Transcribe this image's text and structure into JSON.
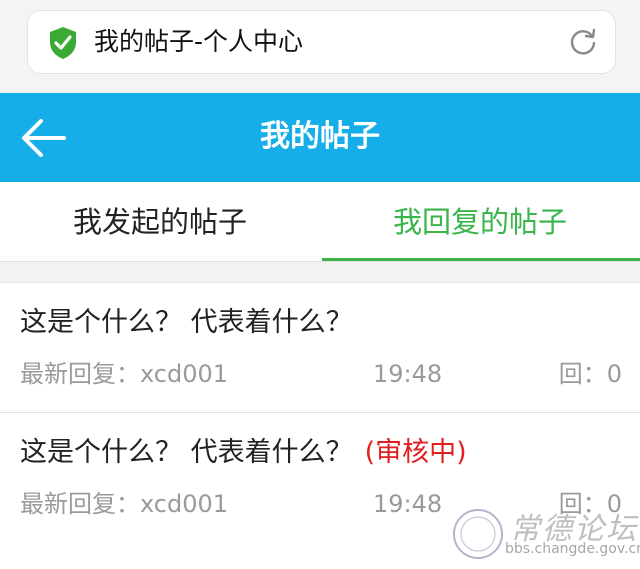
{
  "browser": {
    "page_title": "我的帖子-个人中心",
    "security_icon": "shield-check-icon",
    "reload_icon": "reload-icon",
    "accent": "#3aaa35"
  },
  "header": {
    "title": "我的帖子",
    "back_icon": "back-arrow-icon",
    "background": "#15aee8"
  },
  "tabs": [
    {
      "label": "我发起的帖子",
      "active": false
    },
    {
      "label": "我回复的帖子",
      "active": true
    }
  ],
  "tab_active_color": "#39b54a",
  "posts": [
    {
      "title": "这是个什么？ 代表着什么？",
      "status": "",
      "latest_reply": "最新回复：xcd001",
      "time": "19:48",
      "reply_count": "回：0"
    },
    {
      "title": "这是个什么？ 代表着什么？",
      "status": "(审核中)",
      "latest_reply": "最新回复：xcd001",
      "time": "19:48",
      "reply_count": "回：0"
    }
  ],
  "status_color": "#e02020",
  "watermark": {
    "name": "常德论坛",
    "url": "bbs.changde.gov.cn"
  }
}
